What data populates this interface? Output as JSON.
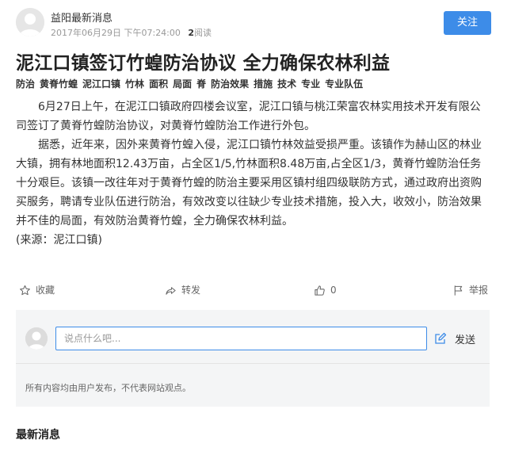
{
  "header": {
    "author": "益阳最新消息",
    "date": "2017年06月29日 下午07:24:00",
    "reads_count": "2",
    "reads_label": "阅读",
    "follow_label": "关注"
  },
  "article": {
    "title": "泥江口镇签订竹蝗防治协议 全力确保农林利益",
    "tags": [
      "防治",
      "黄脊竹蝗",
      "泥江口镇",
      "竹林",
      "面积",
      "局面",
      "脊",
      "防治效果",
      "措施",
      "技术",
      "专业",
      "专业队伍"
    ],
    "paragraphs": [
      "6月27日上午，在泥江口镇政府四楼会议室，泥江口镇与桃江荣富农林实用技术开发有限公司签订了黄脊竹蝗防治协议，对黄脊竹蝗防治工作进行外包。",
      "据悉，近年来，因外来黄脊竹蝗入侵，泥江口镇竹林效益受损严重。该镇作为赫山区的林业大镇，拥有林地面积12.43万亩，占全区1/5,竹林面积8.48万亩,占全区1/3，黄脊竹蝗防治任务十分艰巨。该镇一改往年对于黄脊竹蝗的防治主要采用区镇村组四级联防方式，通过政府出资购买服务，聘请专业队伍进行防治，有效改变以往缺少专业技术措施，投入大，收效小，防治效果并不佳的局面，有效防治黄脊竹蝗，全力确保农林利益。"
    ],
    "source": "(来源：泥江口镇)"
  },
  "actions": {
    "collect": "收藏",
    "share": "转发",
    "like_count": "0",
    "report": "举报"
  },
  "comment": {
    "placeholder": "说点什么吧...",
    "value": "",
    "send_label": "发送",
    "disclaimer": "所有内容均由用户发布，不代表网站观点。"
  },
  "latest_section": {
    "title": "最新消息"
  },
  "colors": {
    "accent": "#3d8ce8",
    "comment_bg": "#f4f5f6"
  }
}
